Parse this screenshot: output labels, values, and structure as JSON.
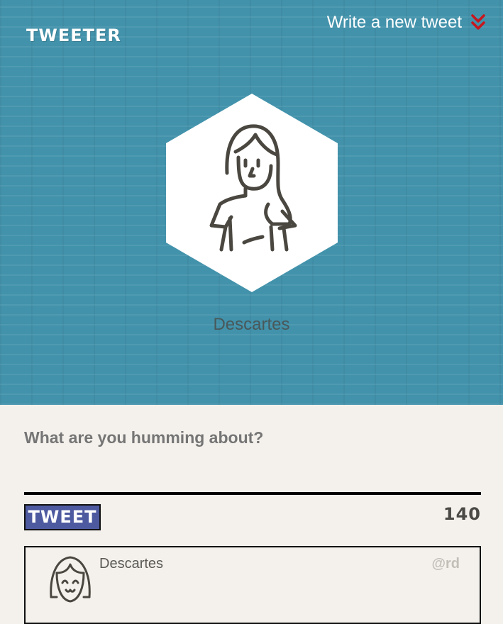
{
  "header": {
    "brand": "TWEETER",
    "write_link_label": "Write a new tweet",
    "write_link_icon": "double-chevron-down-icon",
    "accent_color": "#c8161d"
  },
  "profile": {
    "avatar_icon": "woman-avatar-icon",
    "name": "Descartes"
  },
  "compose": {
    "placeholder": "What are you humming about?",
    "value": "",
    "tweet_button_label": "TWEET",
    "char_count": "140"
  },
  "tweets": [
    {
      "avatar_icon": "smiling-girl-avatar-icon",
      "author": "Descartes",
      "handle": "@rd"
    }
  ],
  "colors": {
    "hero_background": "#4292ab",
    "page_background": "#f4f1ec",
    "tweet_button": "#4e5aa0"
  }
}
